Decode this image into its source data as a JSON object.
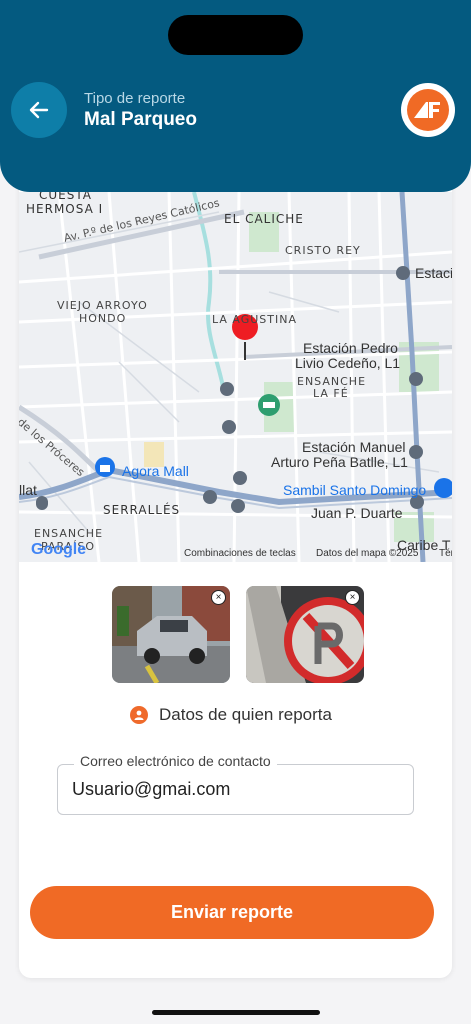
{
  "header": {
    "subtitle": "Tipo de reporte",
    "title": "Mal Parqueo",
    "back_icon": "arrow-left-icon",
    "logo": "app-logo"
  },
  "map": {
    "labels": {
      "cuesta": "CUESTA",
      "hermosa": "HERMOSA I",
      "el_caliche": "EL CALICHE",
      "reyes": "Av. P.º de los Reyes Católicos",
      "cristo_rey": "CRISTO REY",
      "estaci": "Estaci",
      "viejo_arroyo": "VIEJO ARROYO",
      "hondo": "HONDO",
      "la_agustina": "LA AGUSTINA",
      "estacion_pedro": "Estación Pedro",
      "livio": "Livio Cedeño, L1",
      "ensanche": "ENSANCHE",
      "la_fe": "LA FÉ",
      "proceres": "de los Próceres",
      "estacion_manuel": "Estación Manuel",
      "arturo": "Arturo Peña Batlle, L1",
      "agora": "Agora Mall",
      "llat": "llat",
      "sambil": "Sambil Santo Domingo",
      "serralles": "SERRALLÉS",
      "juan_duarte": "Juan P. Duarte",
      "ensanche_paraiso": "ENSANCHE",
      "paraiso": "PARAÍSO",
      "caribe": "Caribe T"
    },
    "footer": {
      "google": "Google",
      "shortcuts": "Combinaciones de teclas",
      "map_data": "Datos del mapa ©2025",
      "terms": "Tér"
    }
  },
  "photos": [
    {
      "name": "photo-car",
      "close": "×"
    },
    {
      "name": "photo-sign",
      "close": "×"
    }
  ],
  "reporter": {
    "icon": "person-icon",
    "label": "Datos de quien reporta"
  },
  "email_field": {
    "label": "Correo electrónico de contacto",
    "value": "Usuario@gmai.com"
  },
  "submit_label": "Enviar reporte",
  "colors": {
    "header": "#045a80",
    "accent": "#f06a25",
    "back_button": "#0e7ea8"
  }
}
